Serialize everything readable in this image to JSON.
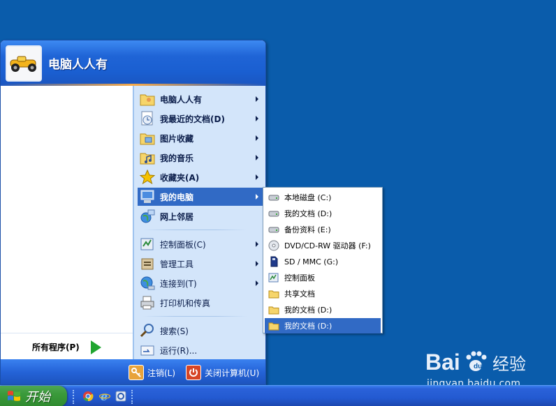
{
  "start_menu": {
    "user_name": "电脑人人有",
    "all_programs": "所有程序(P)",
    "right_items": [
      {
        "label": "电脑人人有",
        "icon": "folder-user-icon",
        "arrow": true
      },
      {
        "label": "我最近的文档(D)",
        "icon": "recent-docs-icon",
        "arrow": true
      },
      {
        "label": "图片收藏",
        "icon": "my-pictures-icon",
        "arrow": true
      },
      {
        "label": "我的音乐",
        "icon": "my-music-icon",
        "arrow": true
      },
      {
        "label": "收藏夹(A)",
        "icon": "favorites-star-icon",
        "arrow": true
      },
      {
        "label": "我的电脑",
        "icon": "my-computer-icon",
        "arrow": true,
        "active": true
      },
      {
        "label": "网上邻居",
        "icon": "network-places-icon",
        "arrow": false
      },
      {
        "label": "控制面板(C)",
        "icon": "control-panel-icon",
        "arrow": true
      },
      {
        "label": "管理工具",
        "icon": "admin-tools-icon",
        "arrow": true
      },
      {
        "label": "连接到(T)",
        "icon": "connect-to-icon",
        "arrow": true
      },
      {
        "label": "打印机和传真",
        "icon": "printer-fax-icon",
        "arrow": false
      },
      {
        "label": "搜索(S)",
        "icon": "search-icon",
        "arrow": false
      },
      {
        "label": "运行(R)...",
        "icon": "run-icon",
        "arrow": false
      }
    ],
    "footer": {
      "logoff": "注销(L)",
      "shutdown": "关闭计算机(U)"
    }
  },
  "submenu": {
    "items": [
      {
        "label": "本地磁盘 (C:)",
        "icon": "hard-disk-icon"
      },
      {
        "label": "我的文档 (D:)",
        "icon": "hard-disk-icon"
      },
      {
        "label": "备份资料 (E:)",
        "icon": "hard-disk-icon"
      },
      {
        "label": "DVD/CD-RW 驱动器 (F:)",
        "icon": "cd-drive-icon"
      },
      {
        "label": "SD / MMC (G:)",
        "icon": "sd-card-icon"
      },
      {
        "label": "控制面板",
        "icon": "control-panel-icon"
      },
      {
        "label": "共享文档",
        "icon": "folder-icon"
      },
      {
        "label": "我的文档 (D:)",
        "icon": "folder-icon"
      },
      {
        "label": "我的文档 (D:)",
        "icon": "folder-icon",
        "active": true
      }
    ]
  },
  "taskbar": {
    "start_label": "开始",
    "quick_launch": [
      "chrome-icon",
      "internet-explorer-icon",
      "app-icon"
    ]
  },
  "watermark": {
    "brand": "Bai du 经验",
    "url": "jingyan.baidu.com"
  },
  "colors": {
    "desktop": "#0a5cab",
    "highlight": "#316ac5",
    "right_pane": "#d3e5fa",
    "start_green": "#3a9a3a"
  }
}
